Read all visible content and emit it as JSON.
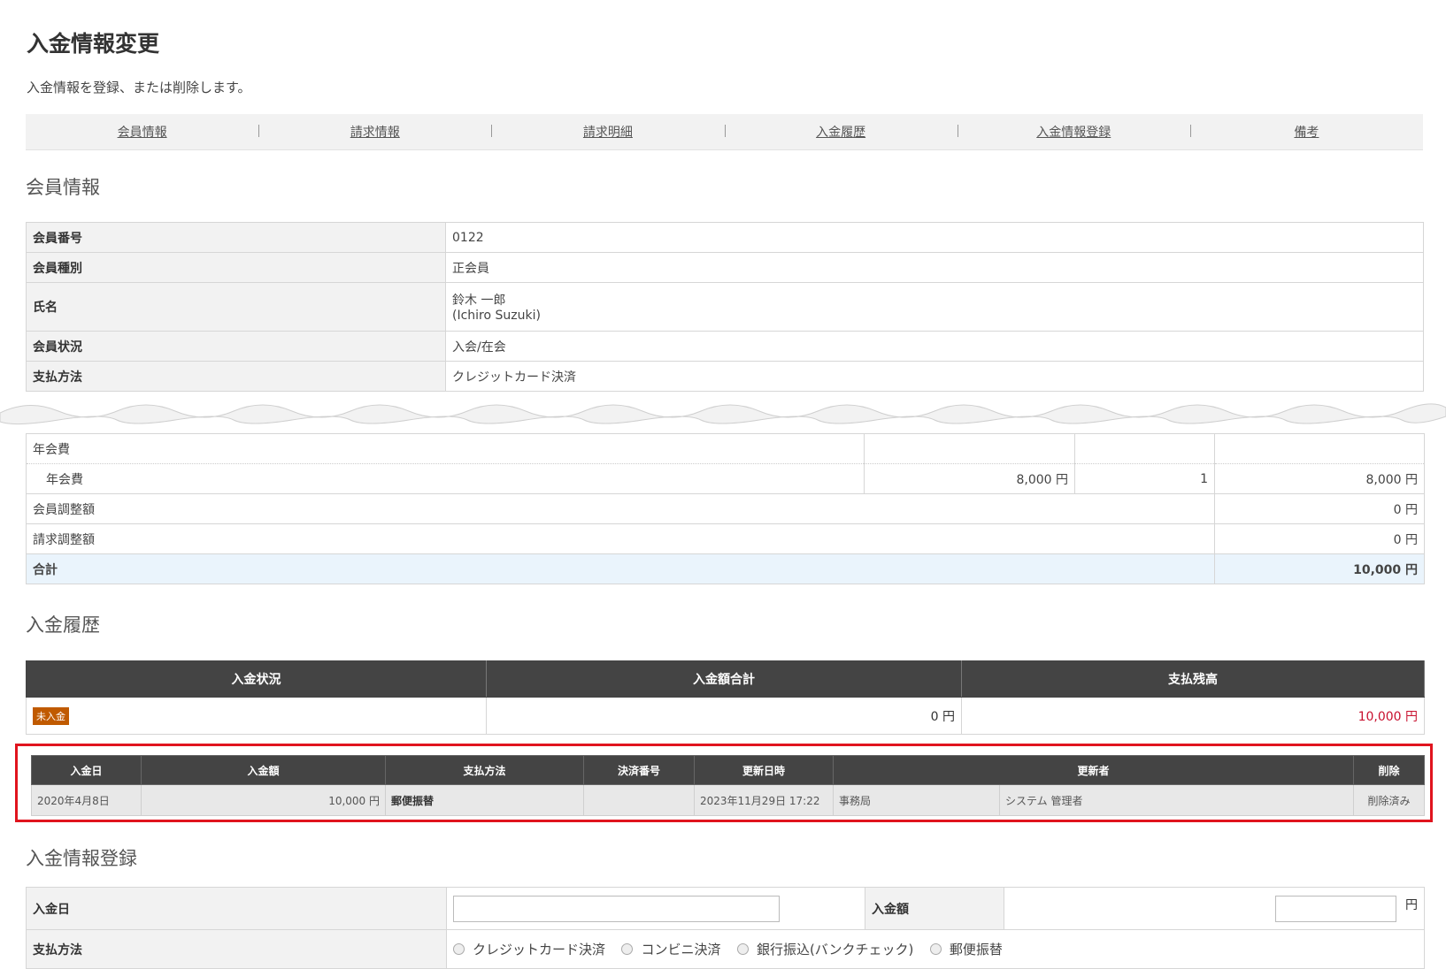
{
  "page": {
    "title": "入金情報変更",
    "description": "入金情報を登録、または削除します。"
  },
  "tabs": [
    "会員情報",
    "請求情報",
    "請求明細",
    "入金履歴",
    "入金情報登録",
    "備考"
  ],
  "member_section": {
    "title": "会員情報",
    "rows": [
      {
        "label": "会員番号",
        "value": "0122"
      },
      {
        "label": "会員種別",
        "value": "正会員"
      },
      {
        "label": "氏名",
        "value": "鈴木 一郎",
        "value2": "(Ichiro Suzuki)"
      },
      {
        "label": "会員状況",
        "value": "入会/在会"
      },
      {
        "label": "支払方法",
        "value": "クレジットカード決済"
      }
    ]
  },
  "fees": {
    "category": "年会費",
    "item": {
      "name": "年会費",
      "unit_price": "8,000 円",
      "quantity": "1",
      "amount": "8,000 円"
    },
    "member_adjust": {
      "label": "会員調整額",
      "amount": "0 円"
    },
    "billing_adjust": {
      "label": "請求調整額",
      "amount": "0 円"
    },
    "total": {
      "label": "合計",
      "amount": "10,000 円"
    }
  },
  "payment_section": {
    "title": "入金履歴",
    "headers": [
      "入金状況",
      "入金額合計",
      "支払残高"
    ],
    "status_badge": "未入金",
    "total_paid": "0 円",
    "balance": "10,000 円",
    "balance_color": "#c8102e"
  },
  "history": {
    "headers": [
      "入金日",
      "入金額",
      "支払方法",
      "決済番号",
      "更新日時",
      "更新者",
      "削除"
    ],
    "rows": [
      {
        "date": "2020年4月8日",
        "amount": "10,000 円",
        "method": "郵便振替",
        "settlement_no": "",
        "updated_at": "2023年11月29日 17:22",
        "updater_dept": "事務局",
        "updater_name": "システム 管理者",
        "delete": "削除済み"
      }
    ]
  },
  "register_section": {
    "title": "入金情報登録",
    "date_label": "入金日",
    "amount_label": "入金額",
    "amount_unit": "円",
    "method_label": "支払方法",
    "method_options": [
      "クレジットカード決済",
      "コンビニ決済",
      "銀行振込(バンクチェック)",
      "郵便振替"
    ]
  },
  "colors": {
    "header_dark": "#444444",
    "badge_orange": "#c05a00",
    "highlight_red": "#e0141e",
    "total_row_bg": "#eaf4fc"
  }
}
